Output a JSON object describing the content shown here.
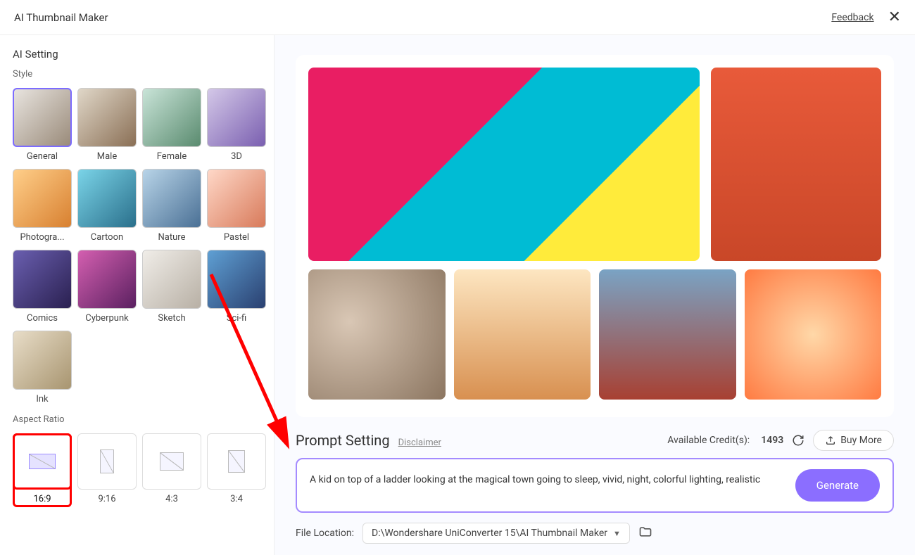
{
  "header": {
    "title": "AI Thumbnail Maker",
    "feedback": "Feedback"
  },
  "sidebar": {
    "section_title": "AI Setting",
    "style_label": "Style",
    "styles": [
      {
        "label": "General",
        "selected": true
      },
      {
        "label": "Male"
      },
      {
        "label": "Female"
      },
      {
        "label": "3D"
      },
      {
        "label": "Photogra..."
      },
      {
        "label": "Cartoon"
      },
      {
        "label": "Nature"
      },
      {
        "label": "Pastel"
      },
      {
        "label": "Comics"
      },
      {
        "label": "Cyberpunk"
      },
      {
        "label": "Sketch"
      },
      {
        "label": "Sci-fi"
      },
      {
        "label": "Ink"
      }
    ],
    "aspect_label": "Aspect Ratio",
    "aspects": [
      {
        "label": "16:9",
        "w": 38,
        "h": 22,
        "highlight": true
      },
      {
        "label": "9:16",
        "w": 20,
        "h": 34
      },
      {
        "label": "4:3",
        "w": 34,
        "h": 26
      },
      {
        "label": "3:4",
        "w": 24,
        "h": 32
      }
    ]
  },
  "prompt": {
    "title": "Prompt Setting",
    "disclaimer": "Disclaimer",
    "credits_label": "Available Credit(s):",
    "credits_value": "1493",
    "buy_label": "Buy More",
    "text": "A kid on top of a ladder looking at the magical town going to sleep, vivid, night, colorful lighting, realistic",
    "generate": "Generate"
  },
  "file": {
    "label": "File Location:",
    "path": "D:\\Wondershare UniConverter 15\\AI Thumbnail Maker"
  }
}
